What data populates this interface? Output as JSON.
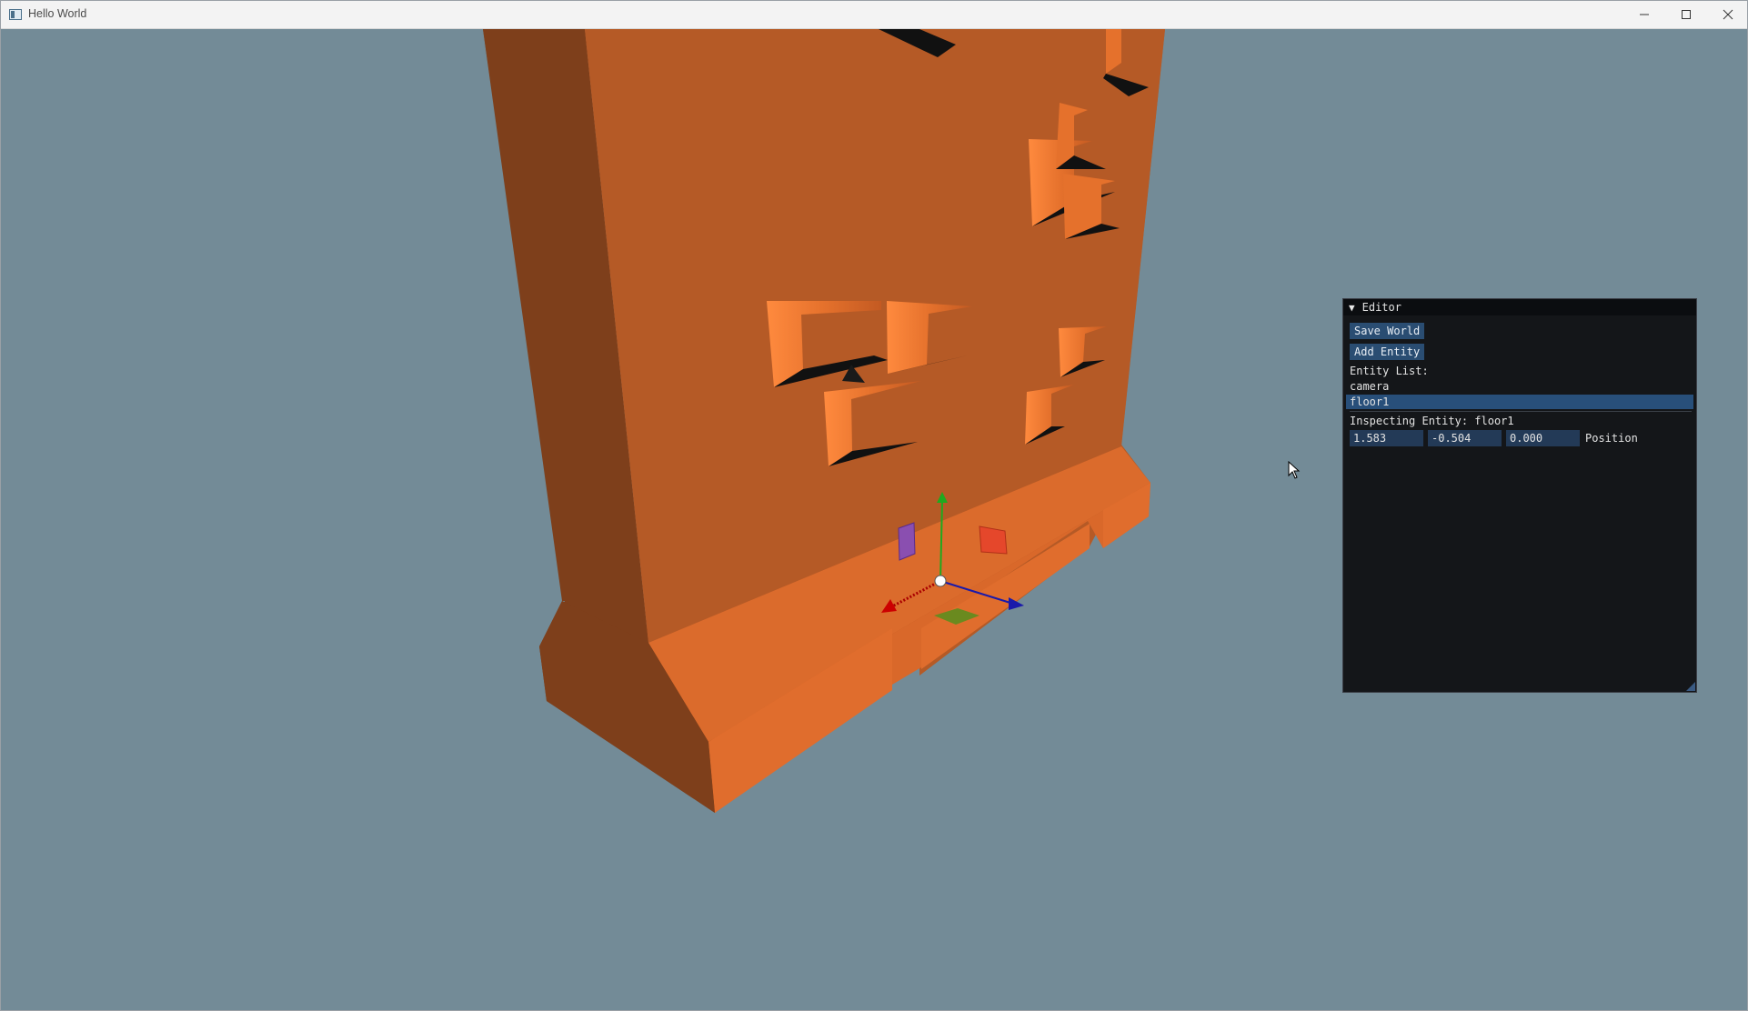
{
  "window": {
    "title": "Hello World"
  },
  "editor": {
    "header": "Editor",
    "save_label": "Save World",
    "add_label": "Add Entity",
    "entity_list_label": "Entity List:",
    "entities": [
      {
        "name": "camera",
        "selected": false
      },
      {
        "name": "floor1",
        "selected": true
      }
    ],
    "inspecting_label": "Inspecting Entity: floor1",
    "position": {
      "x": "1.583",
      "y": "-0.504",
      "z": "0.000",
      "label": "Position"
    }
  },
  "colors": {
    "background": "#738b97",
    "model_main": "#b55a26",
    "model_light": "#db6b2c",
    "model_dark": "#7e3f1b",
    "panel_bg": "#141619",
    "button": "#2a4d72",
    "selection": "#284f7a",
    "gizmo_x": "#cc0000",
    "gizmo_y": "#22aa22",
    "gizmo_z": "#1a1aaa"
  },
  "icons": {
    "minimize": "minimize-icon",
    "maximize": "maximize-icon",
    "close": "close-icon",
    "cursor": "mouse-cursor-icon"
  }
}
